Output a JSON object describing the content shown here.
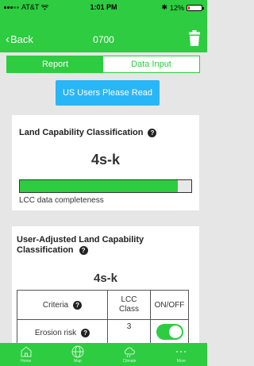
{
  "status_bar": {
    "carrier": "AT&T",
    "time": "1:01 PM",
    "battery": "12%",
    "battery_level": 0.12
  },
  "nav": {
    "back_label": "Back",
    "title": "0700"
  },
  "tabs": [
    {
      "label": "Report",
      "active": true
    },
    {
      "label": "Data Input",
      "active": false
    }
  ],
  "us_button": {
    "label": "US Users Please Read"
  },
  "lcc": {
    "title": "Land Capability Classification",
    "value": "4s-k",
    "completeness_label": "LCC data completeness",
    "completeness": 0.92
  },
  "user_lcc": {
    "title": "User-Adjusted Land Capability Classification",
    "value": "4s-k",
    "table": {
      "headers": [
        "Criteria",
        "LCC Class",
        "ON/OFF"
      ],
      "rows": [
        {
          "criteria": "Erosion risk",
          "class": "3",
          "on": true
        }
      ]
    }
  },
  "bottom_nav": [
    {
      "label": "Home",
      "icon": "home-icon"
    },
    {
      "label": "Map",
      "icon": "globe-icon"
    },
    {
      "label": "Climate",
      "icon": "cloud-icon"
    },
    {
      "label": "More",
      "icon": "more-icon"
    }
  ],
  "colors": {
    "primary": "#2ecc40",
    "accent_button": "#29b6f6"
  }
}
